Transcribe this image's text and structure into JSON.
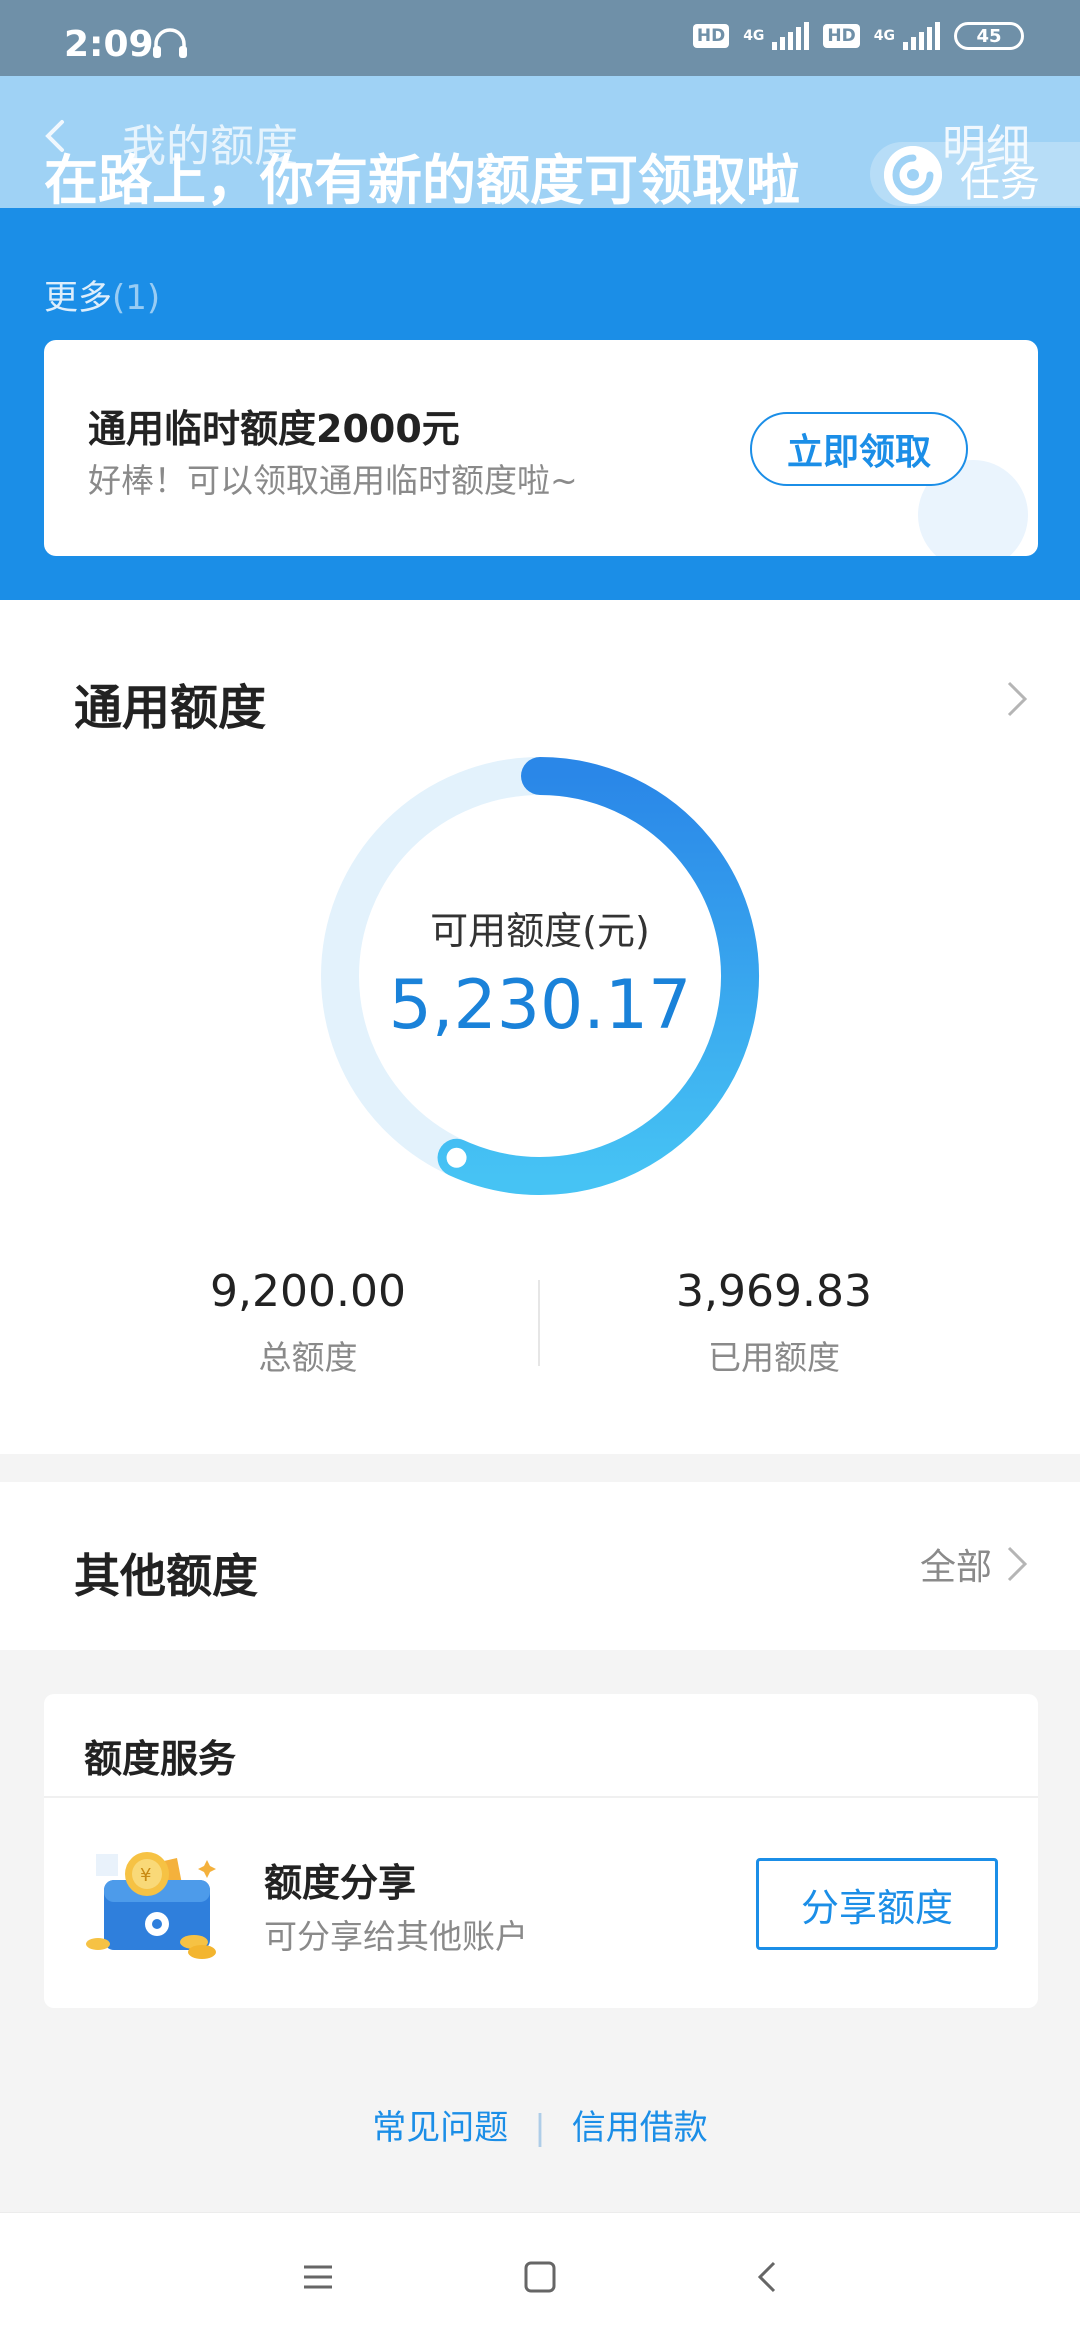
{
  "status_bar": {
    "time": "2:09",
    "icons": [
      "headphone-icon",
      "hd-icon",
      "signal-icon",
      "hd-icon",
      "signal-icon",
      "battery-icon"
    ],
    "hd_label": "HD",
    "network_label": "4G",
    "battery": "45"
  },
  "header": {
    "title": "我的额度",
    "detail_label": "明细",
    "banner_text": "在路上，你有新的额度可领取啦",
    "task_label": "任务",
    "more_label": "更多",
    "more_count": "(1)"
  },
  "promo": {
    "title": "通用临时额度2000元",
    "subtitle": "好棒！可以领取通用临时额度啦~",
    "button": "立即领取"
  },
  "general": {
    "title": "通用额度",
    "available_label": "可用额度(元)",
    "available_value": "5,230.17",
    "available_fraction": 0.5685,
    "total_value": "9,200.00",
    "total_label": "总额度",
    "used_value": "3,969.83",
    "used_label": "已用额度"
  },
  "other": {
    "title": "其他额度",
    "all_label": "全部"
  },
  "service": {
    "header": "额度服务",
    "item_title": "额度分享",
    "item_desc": "可分享给其他账户",
    "button": "分享额度"
  },
  "links": {
    "faq": "常见问题",
    "separator": "|",
    "loan": "信用借款"
  },
  "colors": {
    "primary": "#1b8ee7",
    "banner": "#9fd2f5",
    "status_bar": "#6f90a8"
  }
}
